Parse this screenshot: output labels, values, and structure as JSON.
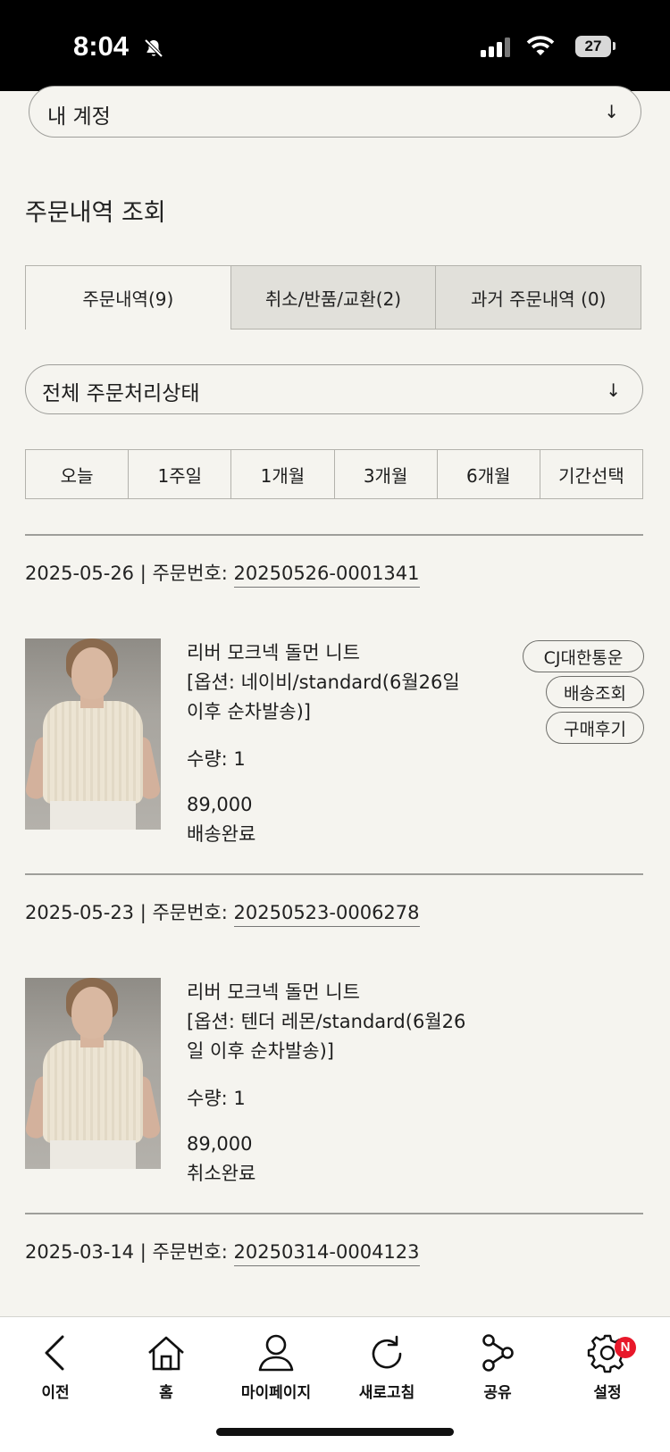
{
  "status_bar": {
    "time": "8:04",
    "battery": "27"
  },
  "account_select": {
    "label": "내 계정"
  },
  "page_title": "주문내역 조회",
  "tabs": [
    {
      "label": "주문내역(9)",
      "active": true
    },
    {
      "label": "취소/반품/교환(2)",
      "active": false
    },
    {
      "label": "과거 주문내역 (0)",
      "active": false
    }
  ],
  "status_filter": {
    "label": "전체 주문처리상태"
  },
  "periods": [
    "오늘",
    "1주일",
    "1개월",
    "3개월",
    "6개월",
    "기간선택"
  ],
  "orders": [
    {
      "date": "2025-05-26",
      "separator": " | 주문번호: ",
      "order_no": "20250526-0001341",
      "product": {
        "name": "리버 모크넥 돌먼 니트",
        "option_line1": "[옵션: 네이비/standard(6월26일",
        "option_line2": "이후 순차발송)]",
        "quantity": "수량: 1",
        "price": "89,000",
        "status": "배송완료"
      },
      "actions": [
        "CJ대한통운",
        "배송조회",
        "구매후기"
      ]
    },
    {
      "date": "2025-05-23",
      "separator": " | 주문번호: ",
      "order_no": "20250523-0006278",
      "product": {
        "name": "리버 모크넥 돌먼 니트",
        "option_line1": "[옵션: 텐더 레몬/standard(6월26",
        "option_line2": "일 이후 순차발송)]",
        "quantity": "수량: 1",
        "price": "89,000",
        "status": "취소완료"
      }
    },
    {
      "date": "2025-03-14",
      "separator": " | 주문번호: ",
      "order_no": "20250314-0004123"
    }
  ],
  "bottom_nav": [
    {
      "label": "이전",
      "icon": "back-icon"
    },
    {
      "label": "홈",
      "icon": "home-icon"
    },
    {
      "label": "마이페이지",
      "icon": "user-icon"
    },
    {
      "label": "새로고침",
      "icon": "refresh-icon"
    },
    {
      "label": "공유",
      "icon": "share-icon"
    },
    {
      "label": "설정",
      "icon": "gear-icon",
      "badge": "N"
    }
  ],
  "colors": {
    "background": "#f5f4ef",
    "badge": "#e8182a",
    "tab_inactive": "#e1e0da"
  }
}
